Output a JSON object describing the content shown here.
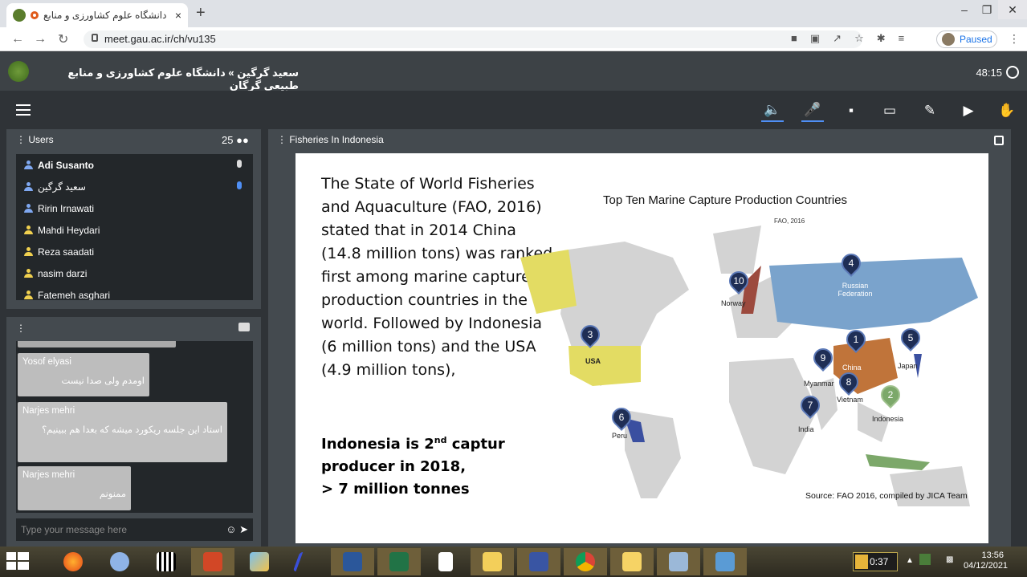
{
  "browser": {
    "tab_title": "دانشگاه علوم کشاورزی و منابع",
    "tab_close": "×",
    "new_tab": "+",
    "url": "meet.gau.ac.ir/ch/vu135",
    "profile_status": "Paused"
  },
  "app": {
    "room_title": "سعید گرگین » دانشگاه علوم کشاورزی و منابع طبیعی گرگان",
    "timer": "48:15"
  },
  "users": {
    "heading": "Users",
    "count": "25",
    "list": [
      {
        "name": "Adi Susanto",
        "bold": true,
        "mic": "white",
        "color": "#7fa8f0"
      },
      {
        "name": "سعید گرگین",
        "mic": "blue",
        "color": "#7fa8f0"
      },
      {
        "name": "Ririn Irnawati",
        "color": "#7fa8f0"
      },
      {
        "name": "Mahdi Heydari",
        "color": "#f0d04f"
      },
      {
        "name": "Reza saadati",
        "color": "#f0d04f"
      },
      {
        "name": "nasim darzi",
        "color": "#f0d04f"
      },
      {
        "name": "Fatemeh asghari",
        "color": "#f0d04f"
      }
    ]
  },
  "chat": {
    "messages": [
      {
        "sender": "Yosof elyasi",
        "text": "اومدم ولی صدا نیست"
      },
      {
        "sender": "Narjes mehri",
        "text": "استاد این جلسه ریکورد میشه که بعدا هم ببینیم؟"
      },
      {
        "sender": "Narjes mehri",
        "text": "ممنونم"
      }
    ],
    "input_placeholder": "Type your message here"
  },
  "presentation": {
    "title": "Fisheries In Indonesia",
    "slide_text": "The State of World Fisheries and Aquaculture (FAO, 2016) stated that in 2014 China (14.8 million tons) was ranked first among marine capture production countries in the world. Followed by Indonesia (6 million tons) and the USA (4.9 million tons),",
    "slide_bold_1": "Indonesia is 2",
    "slide_bold_sup": "nd",
    "slide_bold_2": " captur",
    "slide_bold_3": "producer in 2018,",
    "slide_bold_4": "> 7 million tonnes",
    "map_title": "Top Ten Marine Capture Production Countries",
    "map_subtitle": "FAO, 2016",
    "map_source": "Source: FAO 2016, compiled by JICA Team",
    "countries": [
      {
        "rank": "1",
        "label": "China"
      },
      {
        "rank": "2",
        "label": "Indonesia"
      },
      {
        "rank": "3",
        "label": "USA"
      },
      {
        "rank": "4",
        "label": "Russian Federation"
      },
      {
        "rank": "5",
        "label": "Japan"
      },
      {
        "rank": "6",
        "label": "Peru"
      },
      {
        "rank": "7",
        "label": "India"
      },
      {
        "rank": "8",
        "label": "Vietnam"
      },
      {
        "rank": "9",
        "label": "Myanmar"
      },
      {
        "rank": "10",
        "label": "Norway"
      }
    ]
  },
  "taskbar": {
    "tray_time": "0:37",
    "clock_time": "13:56",
    "clock_date": "04/12/2021",
    "apps": [
      "firefox",
      "r-app",
      "qr-app",
      "powerpoint",
      "paint",
      "adobe",
      "word",
      "excel",
      "notepad",
      "explorer",
      "visio",
      "chrome",
      "folder",
      "monitor",
      "control-panel"
    ]
  }
}
